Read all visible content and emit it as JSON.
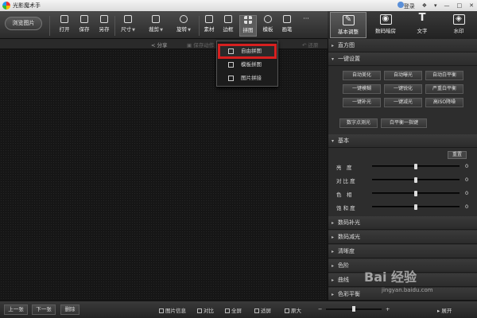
{
  "app": {
    "title": "光影魔术手"
  },
  "titlebar": {
    "login": "登录"
  },
  "toolbar": {
    "browse": "浏览图片",
    "tools": [
      "打开",
      "保存",
      "另存",
      "尺寸",
      "裁剪",
      "旋转",
      "素材",
      "边框",
      "拼图",
      "模板",
      "画笔"
    ],
    "more": "···"
  },
  "right_tabs": [
    "基本调整",
    "数码暗房",
    "文字",
    "水印"
  ],
  "subbar": {
    "share": "分享",
    "save_op": "保存动作",
    "restore": "还原"
  },
  "menu": {
    "items": [
      "自由拼图",
      "模板拼图",
      "图片拼接"
    ]
  },
  "panel": {
    "sections_top": [
      "直方图",
      "一键设置"
    ],
    "one_click": [
      "自动美化",
      "自动曝光",
      "自动白平衡",
      "一键模糊",
      "一键锐化",
      "严重白平衡",
      "一键补光",
      "一键减光",
      "高ISO降噪"
    ],
    "extra_btns": [
      "数字点测光",
      "白平衡一指键"
    ],
    "basic": "基本",
    "reset": "重置",
    "sliders": [
      {
        "label": "亮　度",
        "value": "0",
        "pos": 0.5
      },
      {
        "label": "对 比 度",
        "value": "0",
        "pos": 0.5
      },
      {
        "label": "色　相",
        "value": "0",
        "pos": 0.5
      },
      {
        "label": "饱 和 度",
        "value": "0",
        "pos": 0.5
      }
    ],
    "sections_bottom": [
      "数码补光",
      "数码减光",
      "清晰度",
      "色阶",
      "曲线",
      "色彩平衡"
    ]
  },
  "statusbar": {
    "prev": "上一张",
    "next": "下一张",
    "delete": "删除",
    "info": "图片信息",
    "compare": "对比",
    "fullscreen": "全屏",
    "fit": "适屏",
    "original": "原大",
    "expand": "展开"
  },
  "watermark": {
    "brand": "Bai 经验",
    "url": "jingyan.baidu.com"
  }
}
